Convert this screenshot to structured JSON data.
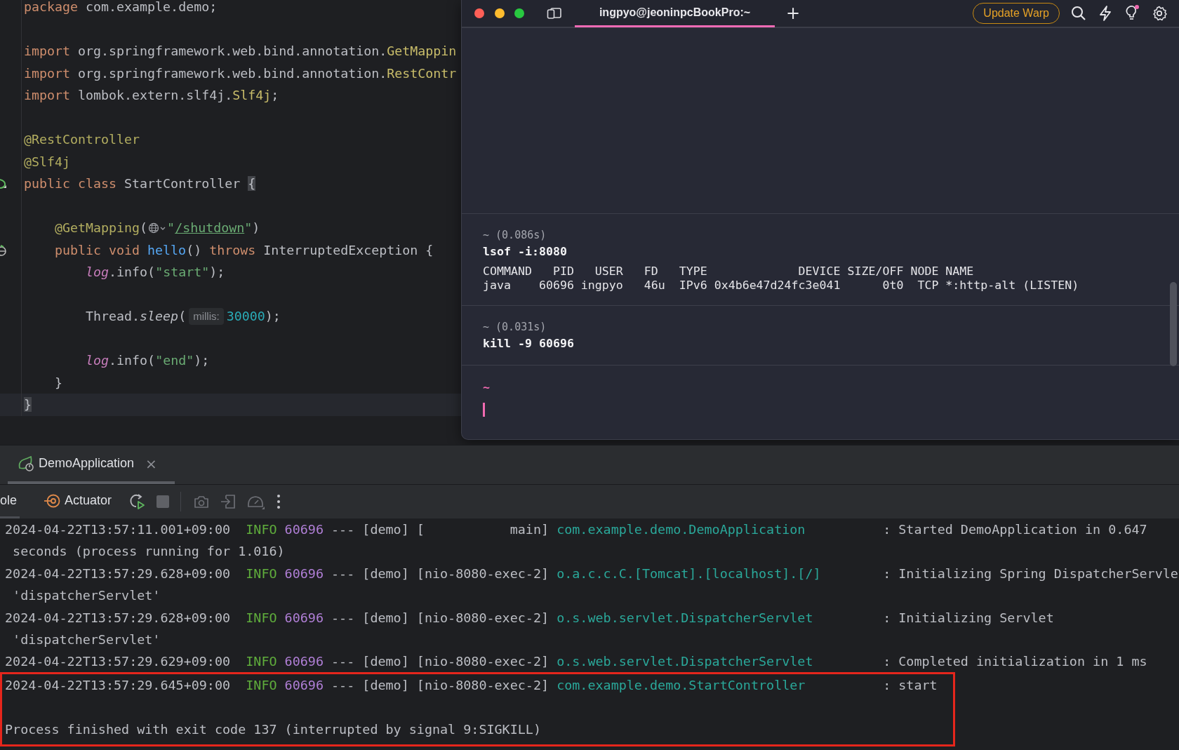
{
  "editor": {
    "lines": [
      {
        "kind": "code",
        "current": false,
        "tokens": [
          {
            "t": "package",
            "kind": "kw"
          },
          {
            "t": " com.example.demo;",
            "kind": "plain"
          }
        ]
      },
      {
        "kind": "blank",
        "current": false
      },
      {
        "kind": "code",
        "current": false,
        "tokens": [
          {
            "t": "import",
            "kind": "kw"
          },
          {
            "t": " org.springframework.web.bind.annotation.",
            "kind": "plain"
          },
          {
            "t": "GetMappin",
            "kind": "type"
          }
        ]
      },
      {
        "kind": "code",
        "current": false,
        "tokens": [
          {
            "t": "import",
            "kind": "kw"
          },
          {
            "t": " org.springframework.web.bind.annotation.",
            "kind": "plain"
          },
          {
            "t": "RestContr",
            "kind": "type"
          }
        ]
      },
      {
        "kind": "code",
        "current": false,
        "tokens": [
          {
            "t": "import",
            "kind": "kw"
          },
          {
            "t": " lombok.extern.slf4j.",
            "kind": "plain"
          },
          {
            "t": "Slf4j",
            "kind": "type"
          },
          {
            "t": ";",
            "kind": "plain"
          }
        ]
      },
      {
        "kind": "blank",
        "current": false
      },
      {
        "kind": "code",
        "current": false,
        "tokens": [
          {
            "t": "@RestController",
            "kind": "ann"
          }
        ]
      },
      {
        "kind": "code",
        "current": false,
        "tokens": [
          {
            "t": "@Slf4j",
            "kind": "ann"
          }
        ]
      },
      {
        "kind": "code",
        "current": false,
        "gutter": {
          "kind": "bean"
        },
        "tokens": [
          {
            "t": "public ",
            "kind": "kw"
          },
          {
            "t": "class",
            "kind": "kw"
          },
          {
            "t": " StartController ",
            "kind": "plain"
          },
          {
            "t": "{",
            "kind": "brace"
          }
        ],
        "children": [
          {
            "kind": "blank",
            "current": false
          },
          {
            "kind": "code",
            "current": false,
            "tokens": [
              {
                "t": "@GetMapping",
                "kind": "ann"
              },
              {
                "t": "(",
                "kind": "plain"
              },
              {
                "kind": "globe"
              },
              {
                "t": "\"",
                "kind": "str"
              },
              {
                "t": "/shutdown",
                "kind": "url"
              },
              {
                "t": "\"",
                "kind": "str"
              },
              {
                "t": ")",
                "kind": "plain"
              }
            ]
          },
          {
            "kind": "code",
            "current": false,
            "gutter": {
              "kind": "web"
            },
            "tokens": [
              {
                "t": "public ",
                "kind": "kw"
              },
              {
                "t": "void ",
                "kind": "kw"
              },
              {
                "t": "hello",
                "kind": "method"
              },
              {
                "t": "() ",
                "kind": "plain"
              },
              {
                "t": "throws",
                "kind": "kw"
              },
              {
                "t": " InterruptedException {",
                "kind": "plain"
              }
            ],
            "children": [
              {
                "kind": "code",
                "current": false,
                "tokens": [
                  {
                    "t": "log",
                    "kind": "field"
                  },
                  {
                    "t": ".info(",
                    "kind": "plain"
                  },
                  {
                    "t": "\"start\"",
                    "kind": "str"
                  },
                  {
                    "t": ");",
                    "kind": "plain"
                  }
                ]
              },
              {
                "kind": "blank",
                "current": false
              },
              {
                "kind": "code",
                "current": false,
                "tokens": [
                  {
                    "t": "Thread.",
                    "kind": "plain"
                  },
                  {
                    "t": "sleep",
                    "kind": "italic"
                  },
                  {
                    "t": "(",
                    "kind": "plain"
                  },
                  {
                    "t": "millis:",
                    "kind": "hint"
                  },
                  {
                    "t": "30000",
                    "kind": "num"
                  },
                  {
                    "t": ");",
                    "kind": "plain"
                  }
                ]
              },
              {
                "kind": "blank",
                "current": false
              },
              {
                "kind": "code",
                "current": false,
                "tokens": [
                  {
                    "t": "log",
                    "kind": "field"
                  },
                  {
                    "t": ".info(",
                    "kind": "plain"
                  },
                  {
                    "t": "\"end\"",
                    "kind": "str"
                  },
                  {
                    "t": ");",
                    "kind": "plain"
                  }
                ]
              }
            ]
          },
          {
            "kind": "code",
            "current": false,
            "tokens": [
              {
                "t": "}",
                "kind": "plain"
              }
            ]
          }
        ]
      },
      {
        "kind": "code",
        "current": true,
        "tokens": [
          {
            "t": "}",
            "kind": "brace"
          }
        ]
      }
    ]
  },
  "terminal": {
    "tab": {
      "label": "ingpyo@jeoninpcBookPro:~",
      "selected": true
    },
    "new_tab": "+",
    "update_button": "Update Warp",
    "blocks": [
      {
        "meta": "~ (0.086s)",
        "command": "lsof -i:8080",
        "output": [
          "COMMAND   PID   USER   FD   TYPE             DEVICE SIZE/OFF NODE NAME",
          "java    60696 ingpyo   46u  IPv6 0x4b6e47d24fc3e041      0t0  TCP *:http-alt (LISTEN)"
        ]
      },
      {
        "meta": "~ (0.031s)",
        "command": "kill -9 60696"
      }
    ],
    "prompt": "~"
  },
  "run_tab": {
    "label": "DemoApplication",
    "selected": true,
    "close": "×"
  },
  "toolbar": {
    "tabs": [
      {
        "label": "ole",
        "selected": true
      },
      {
        "label": "Actuator",
        "selected": false
      }
    ]
  },
  "console": {
    "lines": [
      {
        "kind": "entry",
        "highlighted": false,
        "timestamp": "2024-04-22T13:57:11.001+09:00",
        "level": "INFO",
        "pid": "60696",
        "thread": "--- [demo] [           main]",
        "logger": "com.example.demo.DemoApplication",
        "message": ": Started DemoApplication in 0.647"
      },
      {
        "kind": "wrap",
        "highlighted": false,
        "text": "seconds (process running for 1.016)"
      },
      {
        "kind": "entry",
        "highlighted": false,
        "timestamp": "2024-04-22T13:57:29.628+09:00",
        "level": "INFO",
        "pid": "60696",
        "thread": "--- [demo] [nio-8080-exec-2]",
        "logger": "o.a.c.c.C.[Tomcat].[localhost].[/]",
        "message": ": Initializing Spring DispatcherServle"
      },
      {
        "kind": "wrap",
        "highlighted": false,
        "text": "'dispatcherServlet'"
      },
      {
        "kind": "entry",
        "highlighted": false,
        "timestamp": "2024-04-22T13:57:29.628+09:00",
        "level": "INFO",
        "pid": "60696",
        "thread": "--- [demo] [nio-8080-exec-2]",
        "logger": "o.s.web.servlet.DispatcherServlet",
        "message": ": Initializing Servlet"
      },
      {
        "kind": "wrap",
        "highlighted": false,
        "text": "'dispatcherServlet'"
      },
      {
        "kind": "entry",
        "highlighted": false,
        "timestamp": "2024-04-22T13:57:29.629+09:00",
        "level": "INFO",
        "pid": "60696",
        "thread": "--- [demo] [nio-8080-exec-2]",
        "logger": "o.s.web.servlet.DispatcherServlet",
        "message": ": Completed initialization in 1 ms"
      },
      {
        "kind": "entry",
        "highlighted": true,
        "timestamp": "2024-04-22T13:57:29.645+09:00",
        "level": "INFO",
        "pid": "60696",
        "thread": "--- [demo] [nio-8080-exec-2]",
        "logger": "com.example.demo.StartController",
        "message": ": start"
      },
      {
        "kind": "blank",
        "highlighted": true
      },
      {
        "kind": "exit",
        "highlighted": true,
        "text": "Process finished with exit code 137 (interrupted by signal 9:SIGKILL)"
      }
    ]
  }
}
